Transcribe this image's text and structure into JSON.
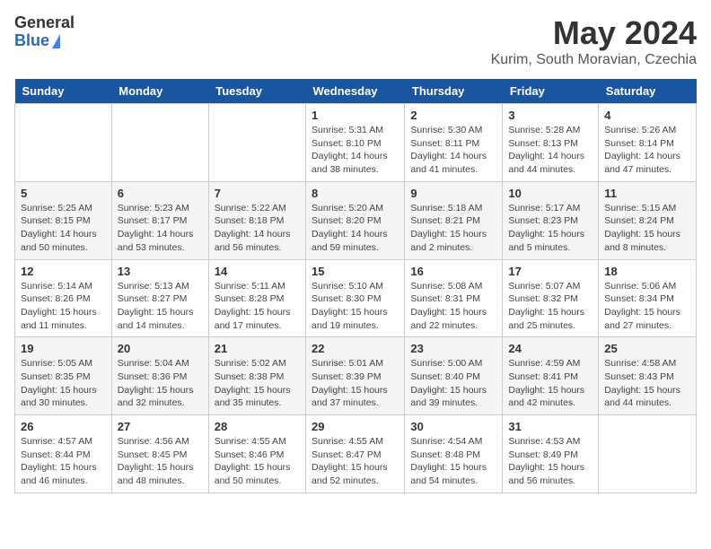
{
  "header": {
    "logo_general": "General",
    "logo_blue": "Blue",
    "month_title": "May 2024",
    "subtitle": "Kurim, South Moravian, Czechia"
  },
  "weekdays": [
    "Sunday",
    "Monday",
    "Tuesday",
    "Wednesday",
    "Thursday",
    "Friday",
    "Saturday"
  ],
  "weeks": [
    [
      {
        "day": "",
        "info": ""
      },
      {
        "day": "",
        "info": ""
      },
      {
        "day": "",
        "info": ""
      },
      {
        "day": "1",
        "info": "Sunrise: 5:31 AM\nSunset: 8:10 PM\nDaylight: 14 hours and 38 minutes."
      },
      {
        "day": "2",
        "info": "Sunrise: 5:30 AM\nSunset: 8:11 PM\nDaylight: 14 hours and 41 minutes."
      },
      {
        "day": "3",
        "info": "Sunrise: 5:28 AM\nSunset: 8:13 PM\nDaylight: 14 hours and 44 minutes."
      },
      {
        "day": "4",
        "info": "Sunrise: 5:26 AM\nSunset: 8:14 PM\nDaylight: 14 hours and 47 minutes."
      }
    ],
    [
      {
        "day": "5",
        "info": "Sunrise: 5:25 AM\nSunset: 8:15 PM\nDaylight: 14 hours and 50 minutes."
      },
      {
        "day": "6",
        "info": "Sunrise: 5:23 AM\nSunset: 8:17 PM\nDaylight: 14 hours and 53 minutes."
      },
      {
        "day": "7",
        "info": "Sunrise: 5:22 AM\nSunset: 8:18 PM\nDaylight: 14 hours and 56 minutes."
      },
      {
        "day": "8",
        "info": "Sunrise: 5:20 AM\nSunset: 8:20 PM\nDaylight: 14 hours and 59 minutes."
      },
      {
        "day": "9",
        "info": "Sunrise: 5:18 AM\nSunset: 8:21 PM\nDaylight: 15 hours and 2 minutes."
      },
      {
        "day": "10",
        "info": "Sunrise: 5:17 AM\nSunset: 8:23 PM\nDaylight: 15 hours and 5 minutes."
      },
      {
        "day": "11",
        "info": "Sunrise: 5:15 AM\nSunset: 8:24 PM\nDaylight: 15 hours and 8 minutes."
      }
    ],
    [
      {
        "day": "12",
        "info": "Sunrise: 5:14 AM\nSunset: 8:26 PM\nDaylight: 15 hours and 11 minutes."
      },
      {
        "day": "13",
        "info": "Sunrise: 5:13 AM\nSunset: 8:27 PM\nDaylight: 15 hours and 14 minutes."
      },
      {
        "day": "14",
        "info": "Sunrise: 5:11 AM\nSunset: 8:28 PM\nDaylight: 15 hours and 17 minutes."
      },
      {
        "day": "15",
        "info": "Sunrise: 5:10 AM\nSunset: 8:30 PM\nDaylight: 15 hours and 19 minutes."
      },
      {
        "day": "16",
        "info": "Sunrise: 5:08 AM\nSunset: 8:31 PM\nDaylight: 15 hours and 22 minutes."
      },
      {
        "day": "17",
        "info": "Sunrise: 5:07 AM\nSunset: 8:32 PM\nDaylight: 15 hours and 25 minutes."
      },
      {
        "day": "18",
        "info": "Sunrise: 5:06 AM\nSunset: 8:34 PM\nDaylight: 15 hours and 27 minutes."
      }
    ],
    [
      {
        "day": "19",
        "info": "Sunrise: 5:05 AM\nSunset: 8:35 PM\nDaylight: 15 hours and 30 minutes."
      },
      {
        "day": "20",
        "info": "Sunrise: 5:04 AM\nSunset: 8:36 PM\nDaylight: 15 hours and 32 minutes."
      },
      {
        "day": "21",
        "info": "Sunrise: 5:02 AM\nSunset: 8:38 PM\nDaylight: 15 hours and 35 minutes."
      },
      {
        "day": "22",
        "info": "Sunrise: 5:01 AM\nSunset: 8:39 PM\nDaylight: 15 hours and 37 minutes."
      },
      {
        "day": "23",
        "info": "Sunrise: 5:00 AM\nSunset: 8:40 PM\nDaylight: 15 hours and 39 minutes."
      },
      {
        "day": "24",
        "info": "Sunrise: 4:59 AM\nSunset: 8:41 PM\nDaylight: 15 hours and 42 minutes."
      },
      {
        "day": "25",
        "info": "Sunrise: 4:58 AM\nSunset: 8:43 PM\nDaylight: 15 hours and 44 minutes."
      }
    ],
    [
      {
        "day": "26",
        "info": "Sunrise: 4:57 AM\nSunset: 8:44 PM\nDaylight: 15 hours and 46 minutes."
      },
      {
        "day": "27",
        "info": "Sunrise: 4:56 AM\nSunset: 8:45 PM\nDaylight: 15 hours and 48 minutes."
      },
      {
        "day": "28",
        "info": "Sunrise: 4:55 AM\nSunset: 8:46 PM\nDaylight: 15 hours and 50 minutes."
      },
      {
        "day": "29",
        "info": "Sunrise: 4:55 AM\nSunset: 8:47 PM\nDaylight: 15 hours and 52 minutes."
      },
      {
        "day": "30",
        "info": "Sunrise: 4:54 AM\nSunset: 8:48 PM\nDaylight: 15 hours and 54 minutes."
      },
      {
        "day": "31",
        "info": "Sunrise: 4:53 AM\nSunset: 8:49 PM\nDaylight: 15 hours and 56 minutes."
      },
      {
        "day": "",
        "info": ""
      }
    ]
  ]
}
